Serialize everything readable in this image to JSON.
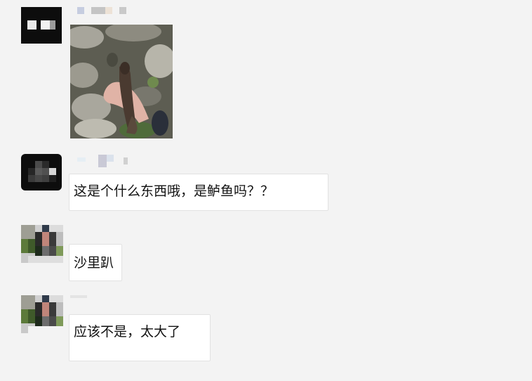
{
  "messages": [
    {
      "sender": "contact-a",
      "type": "image",
      "image_desc": "fish-photo"
    },
    {
      "sender": "contact-a",
      "type": "text",
      "text": "这是个什么东西哦，是鲈鱼吗？？"
    },
    {
      "sender": "contact-b",
      "type": "text",
      "text": "沙里趴"
    },
    {
      "sender": "contact-b",
      "type": "text",
      "text": "应该不是，太大了"
    }
  ],
  "colors": {
    "background": "#f3f3f3",
    "bubble": "#ffffff",
    "bubble_border": "#e2e2e2"
  }
}
